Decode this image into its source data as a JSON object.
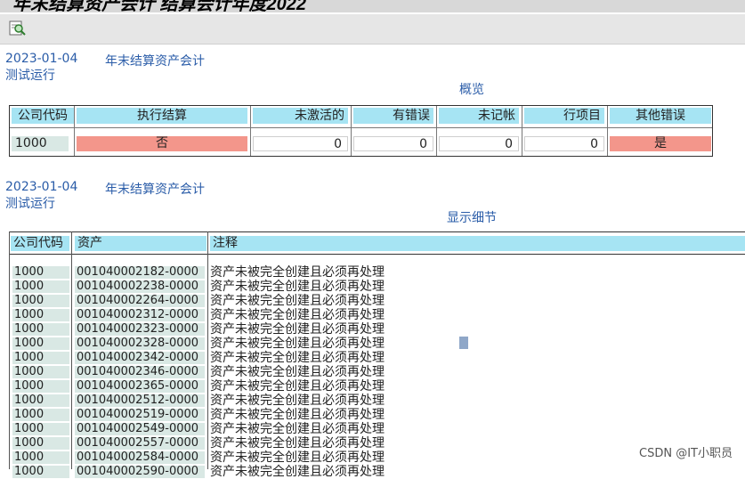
{
  "window": {
    "title": "年末结算资产会计 结算会计年度2022"
  },
  "toolbar": {
    "magnifier_icon": "search-detail-icon"
  },
  "section1": {
    "date": "2023-01-04",
    "title": "年末结算资产会计",
    "run_mode": "测试运行",
    "heading": "概览"
  },
  "overview": {
    "headers": {
      "company_code": "公司代码",
      "run_closing": "执行结算",
      "inactive": "未激活的",
      "with_errors": "有错误",
      "unposted": "未记帐",
      "line_items": "行项目",
      "other_errors": "其他错误"
    },
    "values": {
      "company_code": "1000",
      "run_closing": "否",
      "inactive": "0",
      "with_errors": "0",
      "unposted": "0",
      "line_items": "0",
      "other_errors": "是"
    }
  },
  "section2": {
    "date": "2023-01-04",
    "title": "年末结算资产会计",
    "run_mode": "测试运行",
    "heading": "显示细节"
  },
  "details": {
    "headers": {
      "company_code": "公司代码",
      "asset": "资产",
      "note": "注释"
    },
    "rows": [
      {
        "company": "1000",
        "asset": "001040002182-0000",
        "note": "资产未被完全创建且必须再处理"
      },
      {
        "company": "1000",
        "asset": "001040002238-0000",
        "note": "资产未被完全创建且必须再处理"
      },
      {
        "company": "1000",
        "asset": "001040002264-0000",
        "note": "资产未被完全创建且必须再处理"
      },
      {
        "company": "1000",
        "asset": "001040002312-0000",
        "note": "资产未被完全创建且必须再处理"
      },
      {
        "company": "1000",
        "asset": "001040002323-0000",
        "note": "资产未被完全创建且必须再处理"
      },
      {
        "company": "1000",
        "asset": "001040002328-0000",
        "note": "资产未被完全创建且必须再处理"
      },
      {
        "company": "1000",
        "asset": "001040002342-0000",
        "note": "资产未被完全创建且必须再处理"
      },
      {
        "company": "1000",
        "asset": "001040002346-0000",
        "note": "资产未被完全创建且必须再处理"
      },
      {
        "company": "1000",
        "asset": "001040002365-0000",
        "note": "资产未被完全创建且必须再处理"
      },
      {
        "company": "1000",
        "asset": "001040002512-0000",
        "note": "资产未被完全创建且必须再处理"
      },
      {
        "company": "1000",
        "asset": "001040002519-0000",
        "note": "资产未被完全创建且必须再处理"
      },
      {
        "company": "1000",
        "asset": "001040002549-0000",
        "note": "资产未被完全创建且必须再处理"
      },
      {
        "company": "1000",
        "asset": "001040002557-0000",
        "note": "资产未被完全创建且必须再处理"
      },
      {
        "company": "1000",
        "asset": "001040002584-0000",
        "note": "资产未被完全创建且必须再处理"
      },
      {
        "company": "1000",
        "asset": "001040002590-0000",
        "note": "资产未被完全创建且必须再处理"
      }
    ]
  },
  "watermark": "CSDN @IT小职员",
  "colors": {
    "header_bg": "#a6e4f3",
    "key_bg": "#d9e8e4",
    "alert_bg": "#f3968b",
    "heading_text": "#2a5ca8"
  }
}
